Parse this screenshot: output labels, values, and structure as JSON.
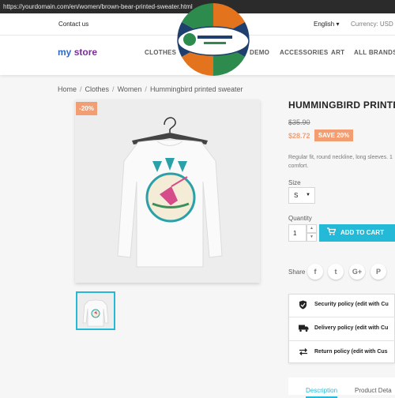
{
  "browser": {
    "url": "https://yourdomain.com/en/women/brown-bear-printed-sweater.html"
  },
  "topnav": {
    "contact": "Contact us",
    "language": "English",
    "currency": "Currency: USD"
  },
  "header": {
    "logo_part1": "my",
    "logo_part2": "store",
    "menu": [
      "CLOTHES",
      "DEMO",
      "ACCESSORIES",
      "ART",
      "ALL BRANDS"
    ]
  },
  "breadcrumb": [
    "Home",
    "Clothes",
    "Women",
    "Hummingbird printed sweater"
  ],
  "product": {
    "discount_flag": "-20%",
    "title": "HUMMINGBIRD PRINTED",
    "regular_price": "$35.90",
    "price": "$28.72",
    "save_label": "SAVE 20%",
    "description_line1": "Regular fit, round neckline, long sleeves. 1",
    "description_line2": "comfort.",
    "size_label": "Size",
    "size_value": "S",
    "quantity_label": "Quantity",
    "quantity_value": "1",
    "add_to_cart": "ADD TO CART",
    "share_label": "Share"
  },
  "social": [
    {
      "name": "facebook-icon",
      "glyph": "f"
    },
    {
      "name": "twitter-icon",
      "glyph": "t"
    },
    {
      "name": "google-plus-icon",
      "glyph": "G+"
    },
    {
      "name": "pinterest-icon",
      "glyph": "P"
    }
  ],
  "policies": [
    {
      "icon": "shield-icon",
      "label": "Security policy (edit with Cu"
    },
    {
      "icon": "truck-icon",
      "label": "Delivery policy (edit with Cu"
    },
    {
      "icon": "exchange-icon",
      "label": "Return policy (edit with Cus"
    }
  ],
  "tabs": {
    "description": "Description",
    "details": "Product Deta"
  },
  "colors": {
    "accent": "#24b9d7",
    "discount": "#f39d72",
    "logo_blue": "#2d6ac5",
    "logo_purple": "#7b2d9a"
  }
}
